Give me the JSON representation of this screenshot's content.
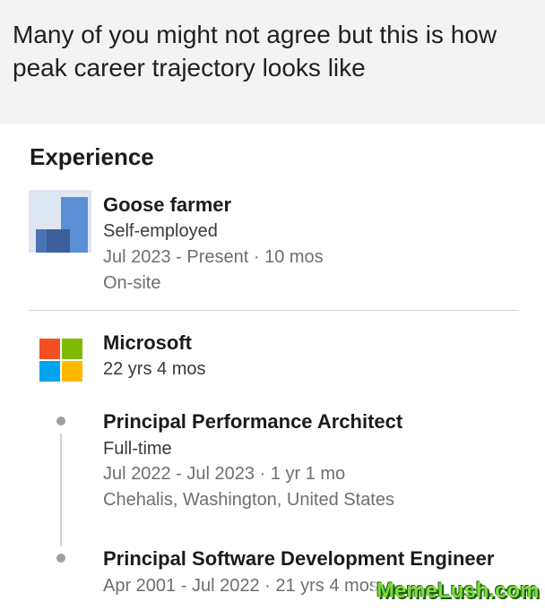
{
  "caption": "Many of you might not agree but this is how peak career trajectory looks like",
  "experience": {
    "section_title": "Experience",
    "goose": {
      "title": "Goose farmer",
      "company": "Self-employed",
      "dates": "Jul 2023 - Present · 10 mos",
      "workplace": "On-site"
    },
    "microsoft": {
      "company": "Microsoft",
      "duration": "22 yrs 4 mos",
      "roles": [
        {
          "title": "Principal Performance Architect",
          "type": "Full-time",
          "dates": "Jul 2022 - Jul 2023 · 1 yr 1 mo",
          "location": "Chehalis, Washington, United States"
        },
        {
          "title": "Principal Software Development Engineer",
          "dates": "Apr 2001 - Jul 2022 · 21 yrs 4 mos"
        }
      ]
    }
  },
  "watermark": "MemeLush.com",
  "colors": {
    "ms_red": "#f25022",
    "ms_green": "#7fba00",
    "ms_blue": "#00a4ef",
    "ms_yellow": "#ffb900",
    "goose_logo_blue": "#5b8fd3"
  }
}
